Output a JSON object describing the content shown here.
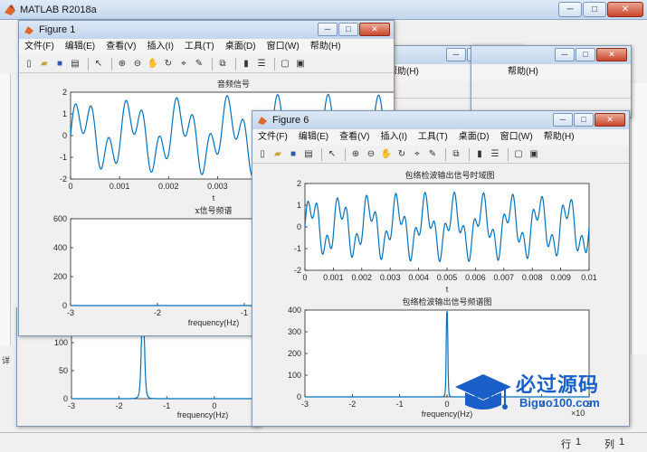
{
  "app": {
    "title": "MATLAB R2018a"
  },
  "status": {
    "row_label": "行",
    "row_value": "1",
    "col_label": "列",
    "col_value": "1"
  },
  "menu": [
    "文件(F)",
    "编辑(E)",
    "查看(V)",
    "插入(I)",
    "工具(T)",
    "桌面(D)",
    "窗口(W)",
    "帮助(H)"
  ],
  "figure1": {
    "title": "Figure 1",
    "top_title": "音频信号",
    "top_xlabel": "t",
    "bottom_title": "x信号频谱",
    "bottom_xlabel": "frequency(Hz)"
  },
  "figure6": {
    "title": "Figure 6",
    "top_title": "包络检波输出信号时域图",
    "top_xlabel": "t",
    "bottom_title": "包络检波输出信号频谱图",
    "bottom_xlabel": "frequency(Hz)",
    "bottom_exp": "×10"
  },
  "behind_figure": {
    "xlabel": "frequency(Hz)"
  },
  "left_panel_char": "详",
  "watermark": {
    "cn": "必过源码",
    "en": "Biguo100.com"
  },
  "chart_data": [
    {
      "type": "line",
      "id": "figure1-audio-signal",
      "title": "音频信号",
      "xlabel": "t",
      "xlim": [
        0,
        0.01
      ],
      "ylim": [
        -2,
        2
      ],
      "xticks": [
        "0",
        "0.001",
        "0.002",
        "0.003",
        "0.004",
        "0.005",
        "0.006"
      ],
      "yticks": [
        "2",
        "1",
        "0",
        "-1",
        "-2"
      ],
      "series": [
        {
          "components": [
            {
              "amp": 1.0,
              "freq": 1000
            },
            {
              "amp": 0.9,
              "freq": 2900
            }
          ]
        }
      ]
    },
    {
      "type": "line",
      "id": "figure1-spectrum",
      "title": "x信号频谱",
      "xlabel": "frequency(Hz)",
      "xlim": [
        -3,
        3
      ],
      "ylim": [
        0,
        600
      ],
      "xticks": [
        "-3",
        "-2",
        "-1",
        "0"
      ],
      "yticks": [
        "600",
        "400",
        "200",
        "0"
      ],
      "peaks": [
        {
          "x": 0,
          "y": 500
        }
      ]
    },
    {
      "type": "line",
      "id": "figure6-envelope-time",
      "title": "包络检波输出信号时域图",
      "xlabel": "t",
      "xlim": [
        0,
        0.01
      ],
      "ylim": [
        -2,
        2
      ],
      "xticks": [
        "0",
        "0.001",
        "0.002",
        "0.003",
        "0.004",
        "0.005",
        "0.006",
        "0.007",
        "0.008",
        "0.009",
        "0.01"
      ],
      "yticks": [
        "2",
        "1",
        "0",
        "-1",
        "-2"
      ],
      "series": [
        {
          "components": [
            {
              "amp": 1.0,
              "freq": 1000
            },
            {
              "amp": 0.6,
              "freq": 2900
            }
          ]
        }
      ]
    },
    {
      "type": "line",
      "id": "figure6-envelope-spectrum",
      "title": "包络检波输出信号频谱图",
      "xlabel": "frequency(Hz)",
      "xlim": [
        -3,
        3
      ],
      "ylim": [
        0,
        400
      ],
      "xticks": [
        "-3",
        "-2",
        "-1",
        "0",
        "1",
        "2",
        "3"
      ],
      "yticks": [
        "400",
        "300",
        "200",
        "100",
        "0"
      ],
      "peaks": [
        {
          "x": 0,
          "y": 395
        }
      ]
    },
    {
      "type": "line",
      "id": "behind-spectrum",
      "xlabel": "frequency(Hz)",
      "xlim": [
        -3,
        0.8
      ],
      "ylim": [
        0,
        150
      ],
      "xticks": [
        "-3",
        "-2",
        "-1",
        "0"
      ],
      "yticks": [
        "100",
        "50",
        "0"
      ],
      "peaks": [
        {
          "x": -1.5,
          "y": 125
        }
      ]
    }
  ]
}
